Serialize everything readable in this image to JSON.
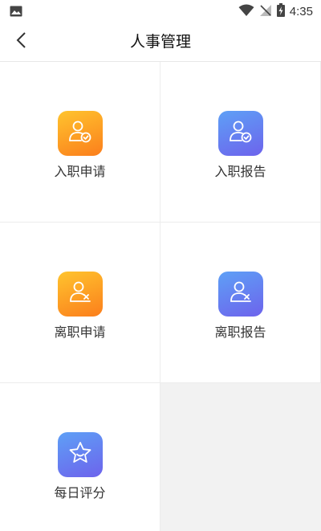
{
  "status_bar": {
    "time": "4:35",
    "icons": [
      "gallery-icon",
      "wifi-icon",
      "no-signal-icon",
      "battery-charging-icon"
    ]
  },
  "header": {
    "title": "人事管理",
    "back_icon": "chevron-left-icon"
  },
  "menu": {
    "items": [
      {
        "label": "入职申请",
        "icon": "user-check-icon",
        "color": "#fb8a1f"
      },
      {
        "label": "入职报告",
        "icon": "user-check-icon",
        "color": "#6a6cee"
      },
      {
        "label": "离职申请",
        "icon": "user-remove-icon",
        "color": "#fb8a1f"
      },
      {
        "label": "离职报告",
        "icon": "user-remove-icon",
        "color": "#6a6cee"
      },
      {
        "label": "每日评分",
        "icon": "star-icon",
        "color": "#6a6cee"
      }
    ]
  },
  "colors": {
    "orange_start": "#ffc42e",
    "orange_end": "#fb7e1c",
    "blue_start": "#5ea0f6",
    "blue_end": "#6d63ec",
    "background": "#f2f2f2"
  }
}
